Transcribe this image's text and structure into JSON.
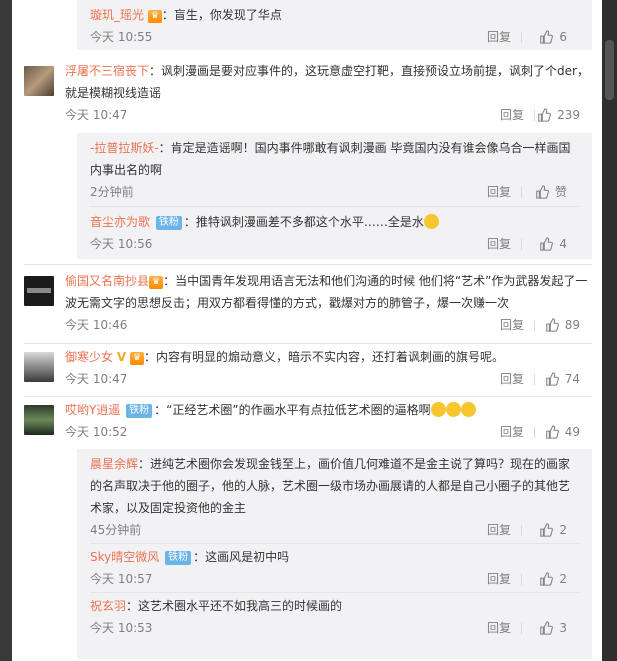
{
  "reply_label": "回复",
  "comments": [
    {
      "name": "浮屠不三宿丧下",
      "text": "：讽刺漫画是要对应事件的，这玩意虚空打靶，直接预设立场前提，讽刺了个der，就是模糊视线造谣",
      "time": "今天 10:47",
      "likes": "239"
    },
    {
      "name": "偷国又名南抄县",
      "text": "：当中国青年发现用语言无法和他们沟通的时候 他们将“艺术”作为武器发起了一波无需文字的思想反击；用双方都看得懂的方式，戳爆对方的肺管子，爆一次赚一次",
      "time": "今天 10:46",
      "likes": "89"
    },
    {
      "name": "御寒少女",
      "text": "：内容有明显的煽动意义，暗示不实内容，还打着讽刺画的旗号呢。",
      "time": "今天 10:47",
      "likes": "74"
    },
    {
      "name": "哎哟Y逍遥",
      "badge": "铁粉",
      "text": "：“正经艺术圈”的作画水平有点拉低艺术圈的逼格啊",
      "time": "今天 10:52",
      "likes": "49"
    }
  ],
  "replies": [
    {
      "name": "璇玑_瑶光",
      "text": "：盲生，你发现了华点",
      "time": "今天 10:55",
      "likes": "6"
    },
    {
      "name": "-拉普拉斯妖-",
      "text": "：肯定是造谣啊！国内事件哪敢有讽刺漫画 毕竟国内没有谁会像乌合一样画国内事出名的啊",
      "time": "2分钟前",
      "likes": "赞"
    },
    {
      "name": "音尘亦为歌",
      "badge": "铁粉",
      "text": "：推特讽刺漫画差不多都这个水平……全是水",
      "time": "今天 10:56",
      "likes": "4"
    },
    {
      "name": "晨星余辉",
      "text": "：进纯艺术圈你会发现金钱至上，画价值几何难道不是金主说了算吗？现在的画家的名声取决于他的圈子，他的人脉，艺术圈一级市场办画展请的人都是自己小圈子的其他艺术家，以及固定投资他的金主",
      "time": "45分钟前",
      "likes": "2"
    },
    {
      "name": "Sky晴空微风",
      "badge": "铁粉",
      "text": "：这画风是初中吗",
      "time": "今天 10:57",
      "likes": "2"
    },
    {
      "name": "祝玄羽",
      "text": "：这艺术圈水平还不如我高三的时候画的",
      "time": "今天 10:53",
      "likes": "3"
    }
  ],
  "badges": {
    "vip_top": "♛",
    "vip_2": "♛",
    "vip_3": "♛"
  },
  "colors": {
    "username": "#eb7350",
    "badge": "#6ab4e8",
    "reply_bg": "#f2f2f5"
  }
}
